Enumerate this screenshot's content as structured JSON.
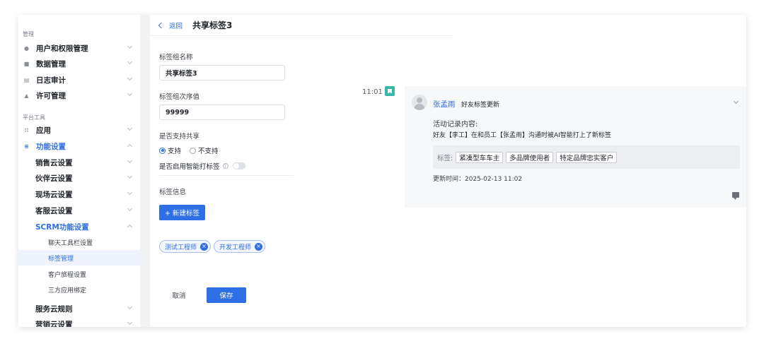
{
  "sidebar": {
    "group_manage": "管理",
    "group_platform": "平台工具",
    "items": [
      {
        "label": "用户和权限管理",
        "icon": "user-icon"
      },
      {
        "label": "数据管理",
        "icon": "database-icon"
      },
      {
        "label": "日志审计",
        "icon": "log-icon"
      },
      {
        "label": "许可管理",
        "icon": "lock-icon"
      },
      {
        "label": "应用",
        "icon": "apps-icon"
      },
      {
        "label": "功能设置",
        "icon": "settings-icon"
      },
      {
        "label": "销售云设置"
      },
      {
        "label": "伙伴云设置"
      },
      {
        "label": "现场云设置"
      },
      {
        "label": "客服云设置"
      },
      {
        "label": "SCRM功能设置"
      },
      {
        "label": "聊天工具栏设置"
      },
      {
        "label": "标签管理"
      },
      {
        "label": "客户旅程设置"
      },
      {
        "label": "三方应用绑定"
      },
      {
        "label": "服务云规则"
      },
      {
        "label": "营销云设置"
      }
    ]
  },
  "form": {
    "back": "返回",
    "title": "共享标签3",
    "name_label": "标签组名称",
    "name_value": "共享标签3",
    "order_label": "标签组次序值",
    "order_value": "99999",
    "share_label": "是否支持共享",
    "share_yes": "支持",
    "share_no": "不支持",
    "smart_label": "是否启用智能打标签",
    "smart_help": "?",
    "tag_info_label": "标签信息",
    "new_tag_button": "+ 新建标签",
    "tags": [
      "测试工程师",
      "开发工程师"
    ],
    "tag_remove": "×",
    "cancel": "取消",
    "save": "保存"
  },
  "activity": {
    "time": "11:01",
    "user": "张孟雨",
    "type": "好友标签更新",
    "content_title": "活动记录内容:",
    "content": "好友【李工】在和员工【张孟雨】沟通时被AI智能打上了新标签",
    "tags_prefix": "标签:",
    "tags": [
      "紧凑型车车主",
      "多品牌使用者",
      "特定品牌忠实客户"
    ],
    "updated": "更新时间：2025-02-13 11:02"
  },
  "colors": {
    "accent": "#2f6fe5",
    "badge": "#3bb5a8"
  }
}
